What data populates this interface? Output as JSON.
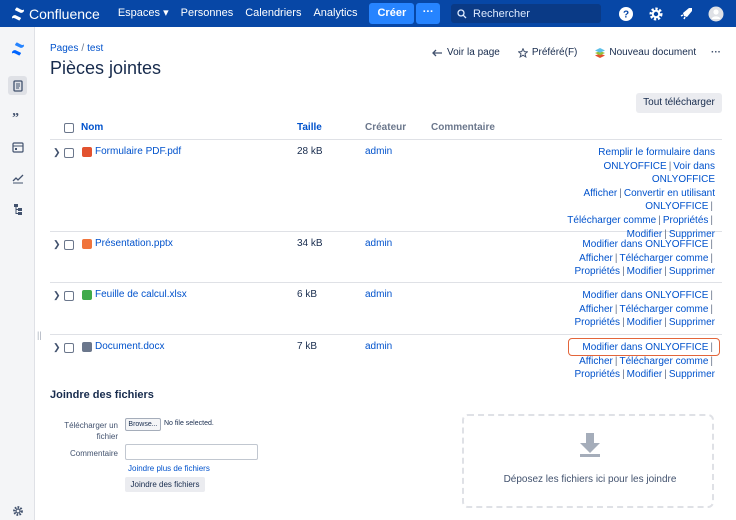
{
  "app": {
    "name": "Confluence"
  },
  "topnav": {
    "items": [
      "Espaces ▾",
      "Personnes",
      "Calendriers",
      "Analytics"
    ],
    "create_label": "Créer",
    "more_label": "···",
    "search_placeholder": "Rechercher",
    "icons": [
      "help-icon",
      "settings-icon",
      "notifications-icon",
      "avatar"
    ]
  },
  "sidebar": {
    "icons": [
      "confluence-logo-icon",
      "pages-icon",
      "blog-quote-icon",
      "calendar-icon",
      "analytics-icon",
      "hierarchy-icon",
      "settings-icon"
    ]
  },
  "breadcrumb": {
    "items": [
      "Pages",
      "test"
    ],
    "separator": "/"
  },
  "page": {
    "title": "Pièces jointes",
    "actions": [
      "Voir la page",
      "Préféré(F)",
      "Nouveau document"
    ],
    "more": "···",
    "download_all": "Tout télécharger"
  },
  "table": {
    "headers": {
      "name": "Nom",
      "size": "Taille",
      "creator": "Créateur",
      "comment": "Commentaire"
    },
    "rows": [
      {
        "name": "Formulaire PDF.pdf",
        "size": "28 kB",
        "creator": "admin",
        "icon": "pdf-file-icon",
        "icon_color": "#E2522F",
        "actions_html": "Remplir le formulaire dans ONLYOFFICE | Voir dans ONLYOFFICE | Afficher | Convertir en utilisant ONLYOFFICE | Télécharger comme | Propriétés | Modifier | Supprimer"
      },
      {
        "name": "Présentation.pptx",
        "size": "34 kB",
        "creator": "admin",
        "icon": "presentation-file-icon",
        "icon_color": "#F0743B",
        "actions_html": "Modifier dans ONLYOFFICE | Afficher | Télécharger comme | Propriétés | Modifier | Supprimer"
      },
      {
        "name": "Feuille de calcul.xlsx",
        "size": "6 kB",
        "creator": "admin",
        "icon": "spreadsheet-file-icon",
        "icon_color": "#3FAA4A",
        "actions_html": "Modifier dans ONLYOFFICE | Afficher | Télécharger comme | Propriétés | Modifier | Supprimer"
      },
      {
        "name": "Document.docx",
        "size": "7 kB",
        "creator": "admin",
        "icon": "document-file-icon",
        "icon_color": "#6B778C",
        "actions_html": "Modifier dans ONLYOFFICE | Afficher | Télécharger comme | Propriétés | Modifier | Supprimer"
      }
    ],
    "row_actions": {
      "pdf": [
        "Remplir le formulaire dans ONLYOFFICE",
        "Voir dans ONLYOFFICE",
        "Afficher",
        "Convertir en utilisant ONLYOFFICE",
        "Télécharger comme",
        "Propriétés",
        "Modifier",
        "Supprimer"
      ],
      "office": [
        "Modifier dans ONLYOFFICE",
        "Afficher",
        "Télécharger comme",
        "Propriétés",
        "Modifier",
        "Supprimer"
      ]
    }
  },
  "attach": {
    "title": "Joindre des fichiers",
    "upload_label": "Télécharger un fichier",
    "browse_label": "Browse...",
    "no_file": "No file selected.",
    "comment_label": "Commentaire",
    "comment_value": "",
    "more_files": "Joindre plus de fichiers",
    "submit": "Joindre des fichiers",
    "drop_text": "Déposez les fichiers ici pour les joindre"
  },
  "colors": {
    "nav": "#0747A6",
    "accent": "#0052CC",
    "highlight": "#E3653A"
  }
}
